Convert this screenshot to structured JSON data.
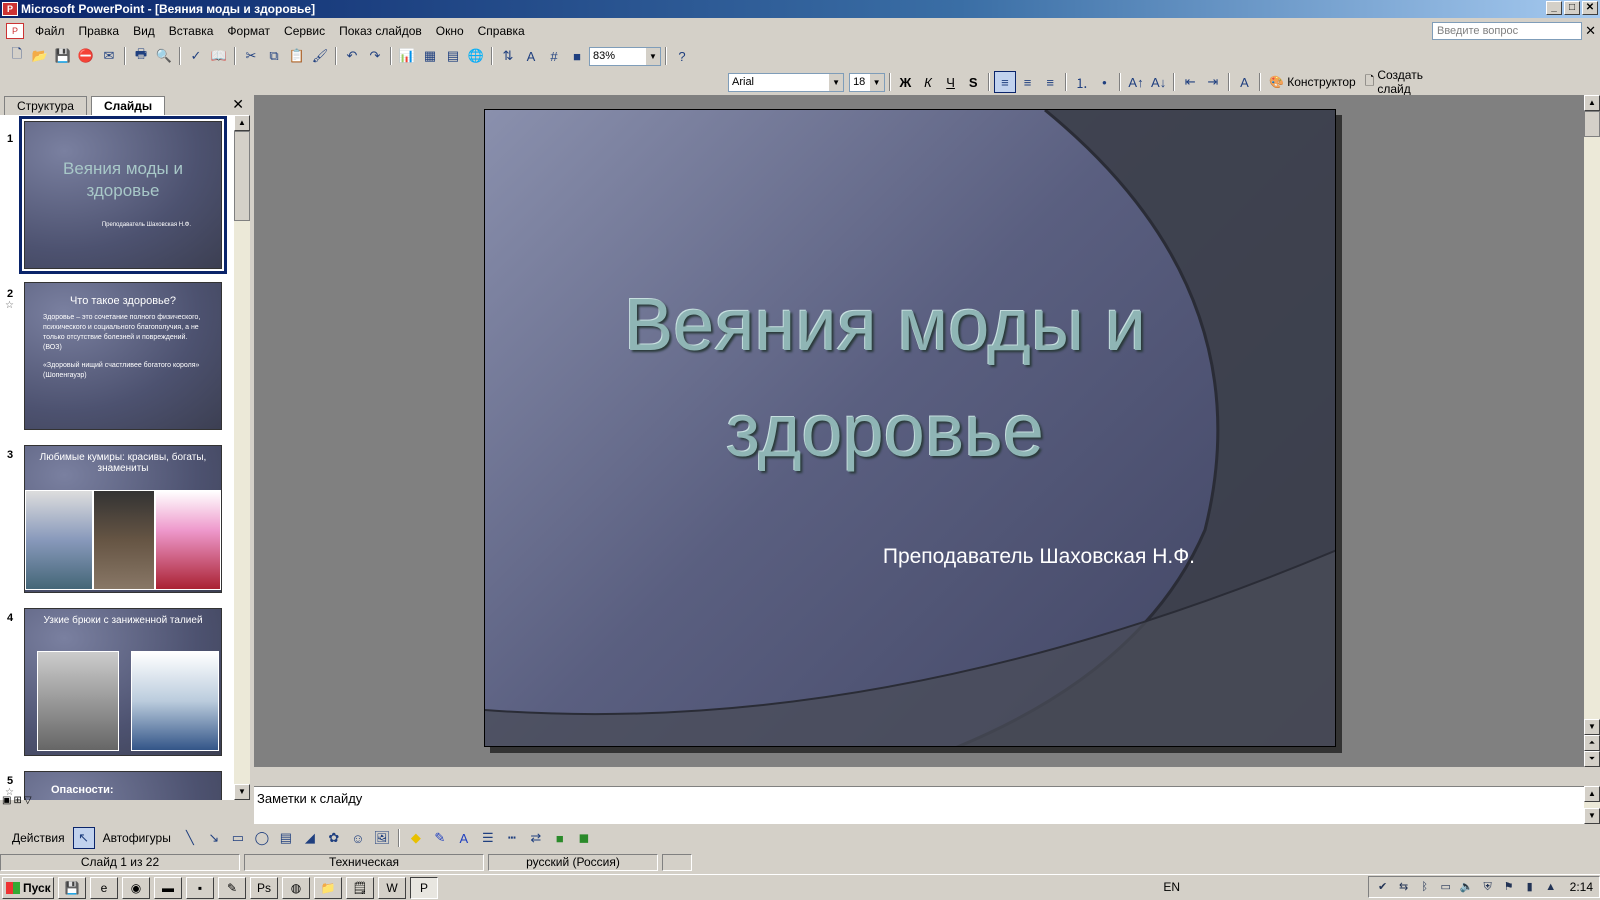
{
  "window": {
    "title": "Microsoft PowerPoint - [Веяния моды и здоровье]",
    "min": "_",
    "max": "□",
    "close": "✕"
  },
  "menu": {
    "items": [
      "Файл",
      "Правка",
      "Вид",
      "Вставка",
      "Формат",
      "Сервис",
      "Показ слайдов",
      "Окно",
      "Справка"
    ],
    "ask_placeholder": "Введите вопрос",
    "close": "✕"
  },
  "standard_toolbar": {
    "zoom": "83%"
  },
  "format_toolbar": {
    "font": "Arial",
    "size": "18",
    "bold": "Ж",
    "italic": "К",
    "underline": "Ч",
    "shadow": "S",
    "designer": "Конструктор",
    "new_slide": "Создать слайд"
  },
  "left_pane": {
    "tabs": [
      "Структура",
      "Слайды"
    ],
    "active_tab": "Слайды",
    "close": "✕",
    "thumbnails": [
      {
        "num": "1",
        "title": "Веяния моды и здоровье",
        "subtitle": "Преподаватель Шаховская Н.Ф.",
        "selected": true
      },
      {
        "num": "2",
        "title": "Что такое здоровье?",
        "body": "Здоровье – это сочетание полного физического, психического и социального благополучия, а не только отсутствие болезней и повреждений. (ВОЗ)",
        "body2": "«Здоровый нищий счастливее богатого короля» (Шопенгауэр)"
      },
      {
        "num": "3",
        "title": "Любимые кумиры: красивы, богаты, знамениты"
      },
      {
        "num": "4",
        "title": "Узкие брюки с заниженной талией"
      },
      {
        "num": "5",
        "title": "Опасности:"
      }
    ]
  },
  "slide": {
    "title": "Веяния моды и здоровье",
    "subtitle": "Преподаватель Шаховская Н.Ф."
  },
  "notes": {
    "placeholder": "Заметки к слайду"
  },
  "drawing_toolbar": {
    "actions": "Действия",
    "autoshapes": "Автофигуры"
  },
  "status": {
    "slide": "Слайд 1 из 22",
    "design": "Техническая",
    "language": "русский (Россия)"
  },
  "taskbar": {
    "start": "Пуск",
    "lang": "EN",
    "time": "2:14"
  }
}
